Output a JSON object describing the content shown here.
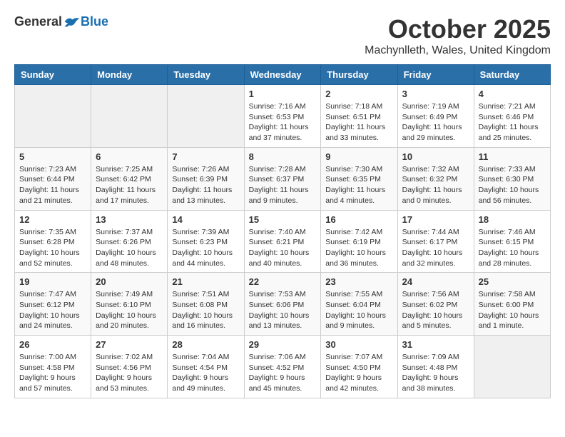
{
  "logo": {
    "general": "General",
    "blue": "Blue"
  },
  "title": "October 2025",
  "location": "Machynlleth, Wales, United Kingdom",
  "days_of_week": [
    "Sunday",
    "Monday",
    "Tuesday",
    "Wednesday",
    "Thursday",
    "Friday",
    "Saturday"
  ],
  "weeks": [
    [
      {
        "day": "",
        "info": ""
      },
      {
        "day": "",
        "info": ""
      },
      {
        "day": "",
        "info": ""
      },
      {
        "day": "1",
        "info": "Sunrise: 7:16 AM\nSunset: 6:53 PM\nDaylight: 11 hours\nand 37 minutes."
      },
      {
        "day": "2",
        "info": "Sunrise: 7:18 AM\nSunset: 6:51 PM\nDaylight: 11 hours\nand 33 minutes."
      },
      {
        "day": "3",
        "info": "Sunrise: 7:19 AM\nSunset: 6:49 PM\nDaylight: 11 hours\nand 29 minutes."
      },
      {
        "day": "4",
        "info": "Sunrise: 7:21 AM\nSunset: 6:46 PM\nDaylight: 11 hours\nand 25 minutes."
      }
    ],
    [
      {
        "day": "5",
        "info": "Sunrise: 7:23 AM\nSunset: 6:44 PM\nDaylight: 11 hours\nand 21 minutes."
      },
      {
        "day": "6",
        "info": "Sunrise: 7:25 AM\nSunset: 6:42 PM\nDaylight: 11 hours\nand 17 minutes."
      },
      {
        "day": "7",
        "info": "Sunrise: 7:26 AM\nSunset: 6:39 PM\nDaylight: 11 hours\nand 13 minutes."
      },
      {
        "day": "8",
        "info": "Sunrise: 7:28 AM\nSunset: 6:37 PM\nDaylight: 11 hours\nand 9 minutes."
      },
      {
        "day": "9",
        "info": "Sunrise: 7:30 AM\nSunset: 6:35 PM\nDaylight: 11 hours\nand 4 minutes."
      },
      {
        "day": "10",
        "info": "Sunrise: 7:32 AM\nSunset: 6:32 PM\nDaylight: 11 hours\nand 0 minutes."
      },
      {
        "day": "11",
        "info": "Sunrise: 7:33 AM\nSunset: 6:30 PM\nDaylight: 10 hours\nand 56 minutes."
      }
    ],
    [
      {
        "day": "12",
        "info": "Sunrise: 7:35 AM\nSunset: 6:28 PM\nDaylight: 10 hours\nand 52 minutes."
      },
      {
        "day": "13",
        "info": "Sunrise: 7:37 AM\nSunset: 6:26 PM\nDaylight: 10 hours\nand 48 minutes."
      },
      {
        "day": "14",
        "info": "Sunrise: 7:39 AM\nSunset: 6:23 PM\nDaylight: 10 hours\nand 44 minutes."
      },
      {
        "day": "15",
        "info": "Sunrise: 7:40 AM\nSunset: 6:21 PM\nDaylight: 10 hours\nand 40 minutes."
      },
      {
        "day": "16",
        "info": "Sunrise: 7:42 AM\nSunset: 6:19 PM\nDaylight: 10 hours\nand 36 minutes."
      },
      {
        "day": "17",
        "info": "Sunrise: 7:44 AM\nSunset: 6:17 PM\nDaylight: 10 hours\nand 32 minutes."
      },
      {
        "day": "18",
        "info": "Sunrise: 7:46 AM\nSunset: 6:15 PM\nDaylight: 10 hours\nand 28 minutes."
      }
    ],
    [
      {
        "day": "19",
        "info": "Sunrise: 7:47 AM\nSunset: 6:12 PM\nDaylight: 10 hours\nand 24 minutes."
      },
      {
        "day": "20",
        "info": "Sunrise: 7:49 AM\nSunset: 6:10 PM\nDaylight: 10 hours\nand 20 minutes."
      },
      {
        "day": "21",
        "info": "Sunrise: 7:51 AM\nSunset: 6:08 PM\nDaylight: 10 hours\nand 16 minutes."
      },
      {
        "day": "22",
        "info": "Sunrise: 7:53 AM\nSunset: 6:06 PM\nDaylight: 10 hours\nand 13 minutes."
      },
      {
        "day": "23",
        "info": "Sunrise: 7:55 AM\nSunset: 6:04 PM\nDaylight: 10 hours\nand 9 minutes."
      },
      {
        "day": "24",
        "info": "Sunrise: 7:56 AM\nSunset: 6:02 PM\nDaylight: 10 hours\nand 5 minutes."
      },
      {
        "day": "25",
        "info": "Sunrise: 7:58 AM\nSunset: 6:00 PM\nDaylight: 10 hours\nand 1 minute."
      }
    ],
    [
      {
        "day": "26",
        "info": "Sunrise: 7:00 AM\nSunset: 4:58 PM\nDaylight: 9 hours\nand 57 minutes."
      },
      {
        "day": "27",
        "info": "Sunrise: 7:02 AM\nSunset: 4:56 PM\nDaylight: 9 hours\nand 53 minutes."
      },
      {
        "day": "28",
        "info": "Sunrise: 7:04 AM\nSunset: 4:54 PM\nDaylight: 9 hours\nand 49 minutes."
      },
      {
        "day": "29",
        "info": "Sunrise: 7:06 AM\nSunset: 4:52 PM\nDaylight: 9 hours\nand 45 minutes."
      },
      {
        "day": "30",
        "info": "Sunrise: 7:07 AM\nSunset: 4:50 PM\nDaylight: 9 hours\nand 42 minutes."
      },
      {
        "day": "31",
        "info": "Sunrise: 7:09 AM\nSunset: 4:48 PM\nDaylight: 9 hours\nand 38 minutes."
      },
      {
        "day": "",
        "info": ""
      }
    ]
  ]
}
